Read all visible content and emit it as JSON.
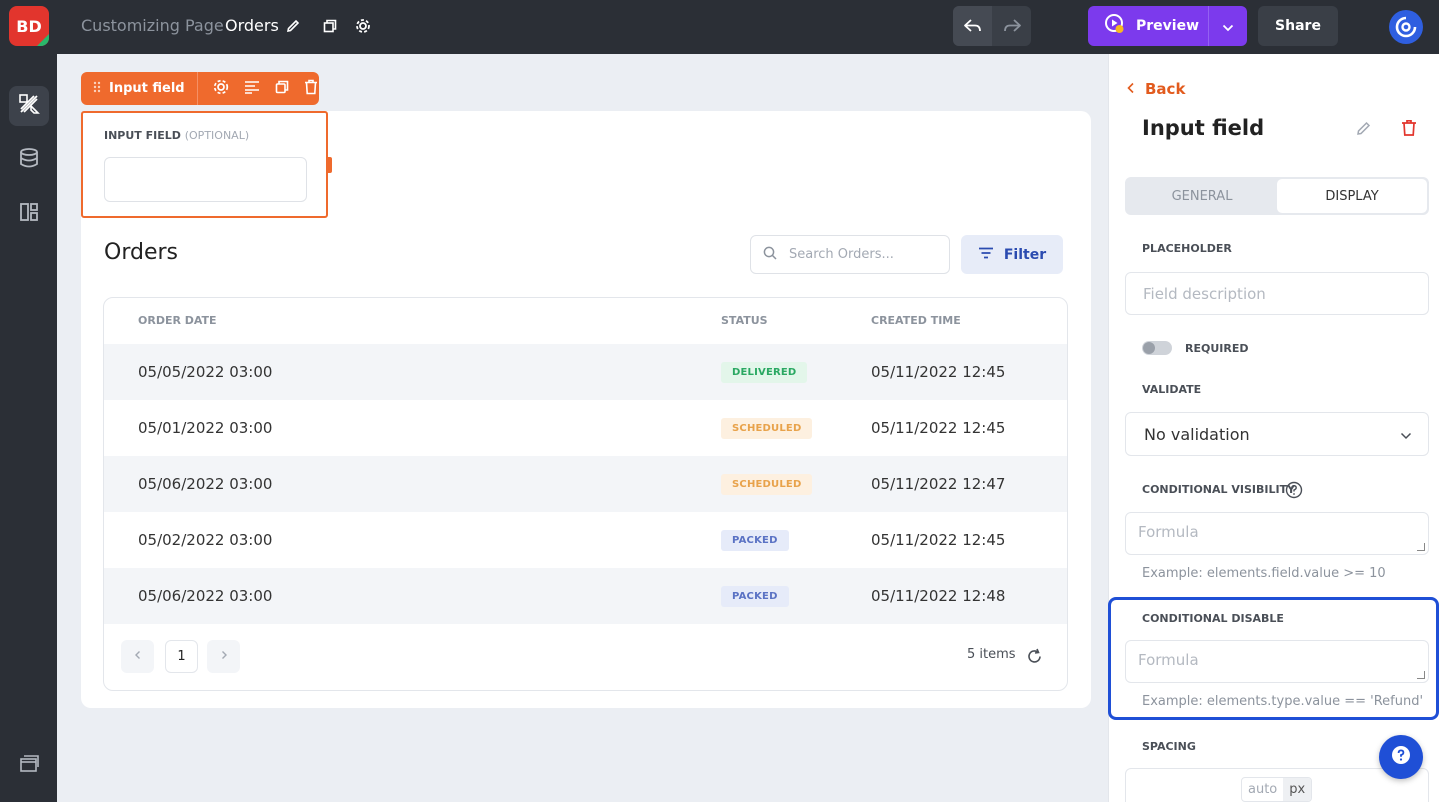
{
  "app": {
    "logo_text": "BD",
    "breadcrumb_parent": "Customizing Page",
    "page_name": "Orders",
    "preview_label": "Preview",
    "share_label": "Share"
  },
  "selection": {
    "element_label": "Input field"
  },
  "input_field": {
    "label": "INPUT FIELD",
    "optional": "(OPTIONAL)",
    "value": ""
  },
  "orders": {
    "title": "Orders",
    "search_placeholder": "Search Orders...",
    "filter_label": "Filter",
    "columns": [
      "ORDER DATE",
      "STATUS",
      "CREATED TIME"
    ],
    "rows": [
      {
        "order_date": "05/05/2022 03:00",
        "status": "DELIVERED",
        "created": "05/11/2022 12:45"
      },
      {
        "order_date": "05/01/2022 03:00",
        "status": "SCHEDULED",
        "created": "05/11/2022 12:45"
      },
      {
        "order_date": "05/06/2022 03:00",
        "status": "SCHEDULED",
        "created": "05/11/2022 12:47"
      },
      {
        "order_date": "05/02/2022 03:00",
        "status": "PACKED",
        "created": "05/11/2022 12:45"
      },
      {
        "order_date": "05/06/2022 03:00",
        "status": "PACKED",
        "created": "05/11/2022 12:48"
      }
    ],
    "current_page": "1",
    "items_count": "5 items"
  },
  "status_colors": {
    "DELIVERED": {
      "bg": "#e3f6ea",
      "fg": "#2aa862"
    },
    "SCHEDULED": {
      "bg": "#fdf0e0",
      "fg": "#e8a24a"
    },
    "PACKED": {
      "bg": "#e6ebf9",
      "fg": "#5a72c4"
    }
  },
  "panel": {
    "back_label": "Back",
    "title": "Input field",
    "tabs": [
      "GENERAL",
      "DISPLAY"
    ],
    "active_tab": "DISPLAY",
    "placeholder_label": "PLACEHOLDER",
    "placeholder_input_placeholder": "Field description",
    "required_label": "REQUIRED",
    "validate_label": "VALIDATE",
    "validate_value": "No validation",
    "cond_visibility_label": "CONDITIONAL VISIBILITY",
    "cond_visibility_placeholder": "Formula",
    "cond_visibility_hint": "Example: elements.field.value >= 10",
    "cond_disable_label": "CONDITIONAL DISABLE",
    "cond_disable_placeholder": "Formula",
    "cond_disable_hint": "Example: elements.type.value == 'Refund'",
    "spacing_label": "SPACING",
    "spacing_units": [
      "auto",
      "px"
    ]
  },
  "colors": {
    "accent_orange": "#ef6a2d",
    "preview_purple": "#7c3aed",
    "highlight_blue": "#1f4fd6"
  }
}
